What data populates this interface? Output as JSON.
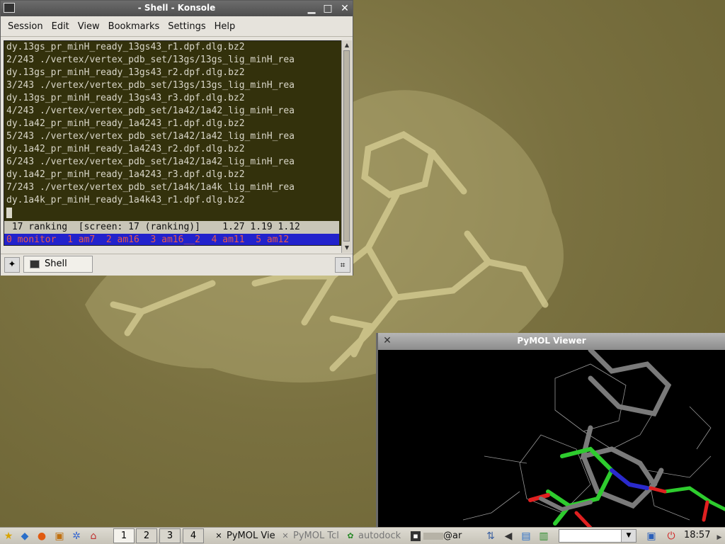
{
  "konsole": {
    "title": "- Shell - Konsole",
    "menu": [
      "Session",
      "Edit",
      "View",
      "Bookmarks",
      "Settings",
      "Help"
    ],
    "lines": [
      "dy.13gs_pr_minH_ready_13gs43_r1.dpf.dlg.bz2",
      "2/243 ./vertex/vertex_pdb_set/13gs/13gs_lig_minH_rea",
      "dy.13gs_pr_minH_ready_13gs43_r2.dpf.dlg.bz2",
      "3/243 ./vertex/vertex_pdb_set/13gs/13gs_lig_minH_rea",
      "dy.13gs_pr_minH_ready_13gs43_r3.dpf.dlg.bz2",
      "4/243 ./vertex/vertex_pdb_set/1a42/1a42_lig_minH_rea",
      "dy.1a42_pr_minH_ready_1a4243_r1.dpf.dlg.bz2",
      "5/243 ./vertex/vertex_pdb_set/1a42/1a42_lig_minH_rea",
      "dy.1a42_pr_minH_ready_1a4243_r2.dpf.dlg.bz2",
      "6/243 ./vertex/vertex_pdb_set/1a42/1a42_lig_minH_rea",
      "dy.1a42_pr_minH_ready_1a4243_r3.dpf.dlg.bz2",
      "7/243 ./vertex/vertex_pdb_set/1a4k/1a4k_lig_minH_rea",
      "dy.1a4k_pr_minH_ready_1a4k43_r1.dpf.dlg.bz2"
    ],
    "status_line": " 17 ranking  [screen: 17 (ranking)]    1.27 1.19 1.12",
    "window_list": "0 monitor  1 am7  2 am16  3 am16__2  4 am11  5 am12",
    "tab_label": "Shell"
  },
  "pymol": {
    "title": "PyMOL Viewer"
  },
  "taskbar": {
    "pager": [
      "1",
      "2",
      "3",
      "4"
    ],
    "tasks": [
      "PyMOL Vie",
      "PyMOL Tcl",
      "autodock",
      "@ar"
    ],
    "clock": "18:57"
  },
  "colors": {
    "terminal_bg": "#33310c",
    "terminal_fg": "#d9d6c8",
    "window_list_bg": "#2222cc",
    "window_list_fg": "#e85a4a",
    "carbon_green": "#2ecc2e",
    "carbon_grey": "#7a7a7a",
    "nitrogen_blue": "#2a2acc",
    "oxygen_red": "#e02020"
  }
}
